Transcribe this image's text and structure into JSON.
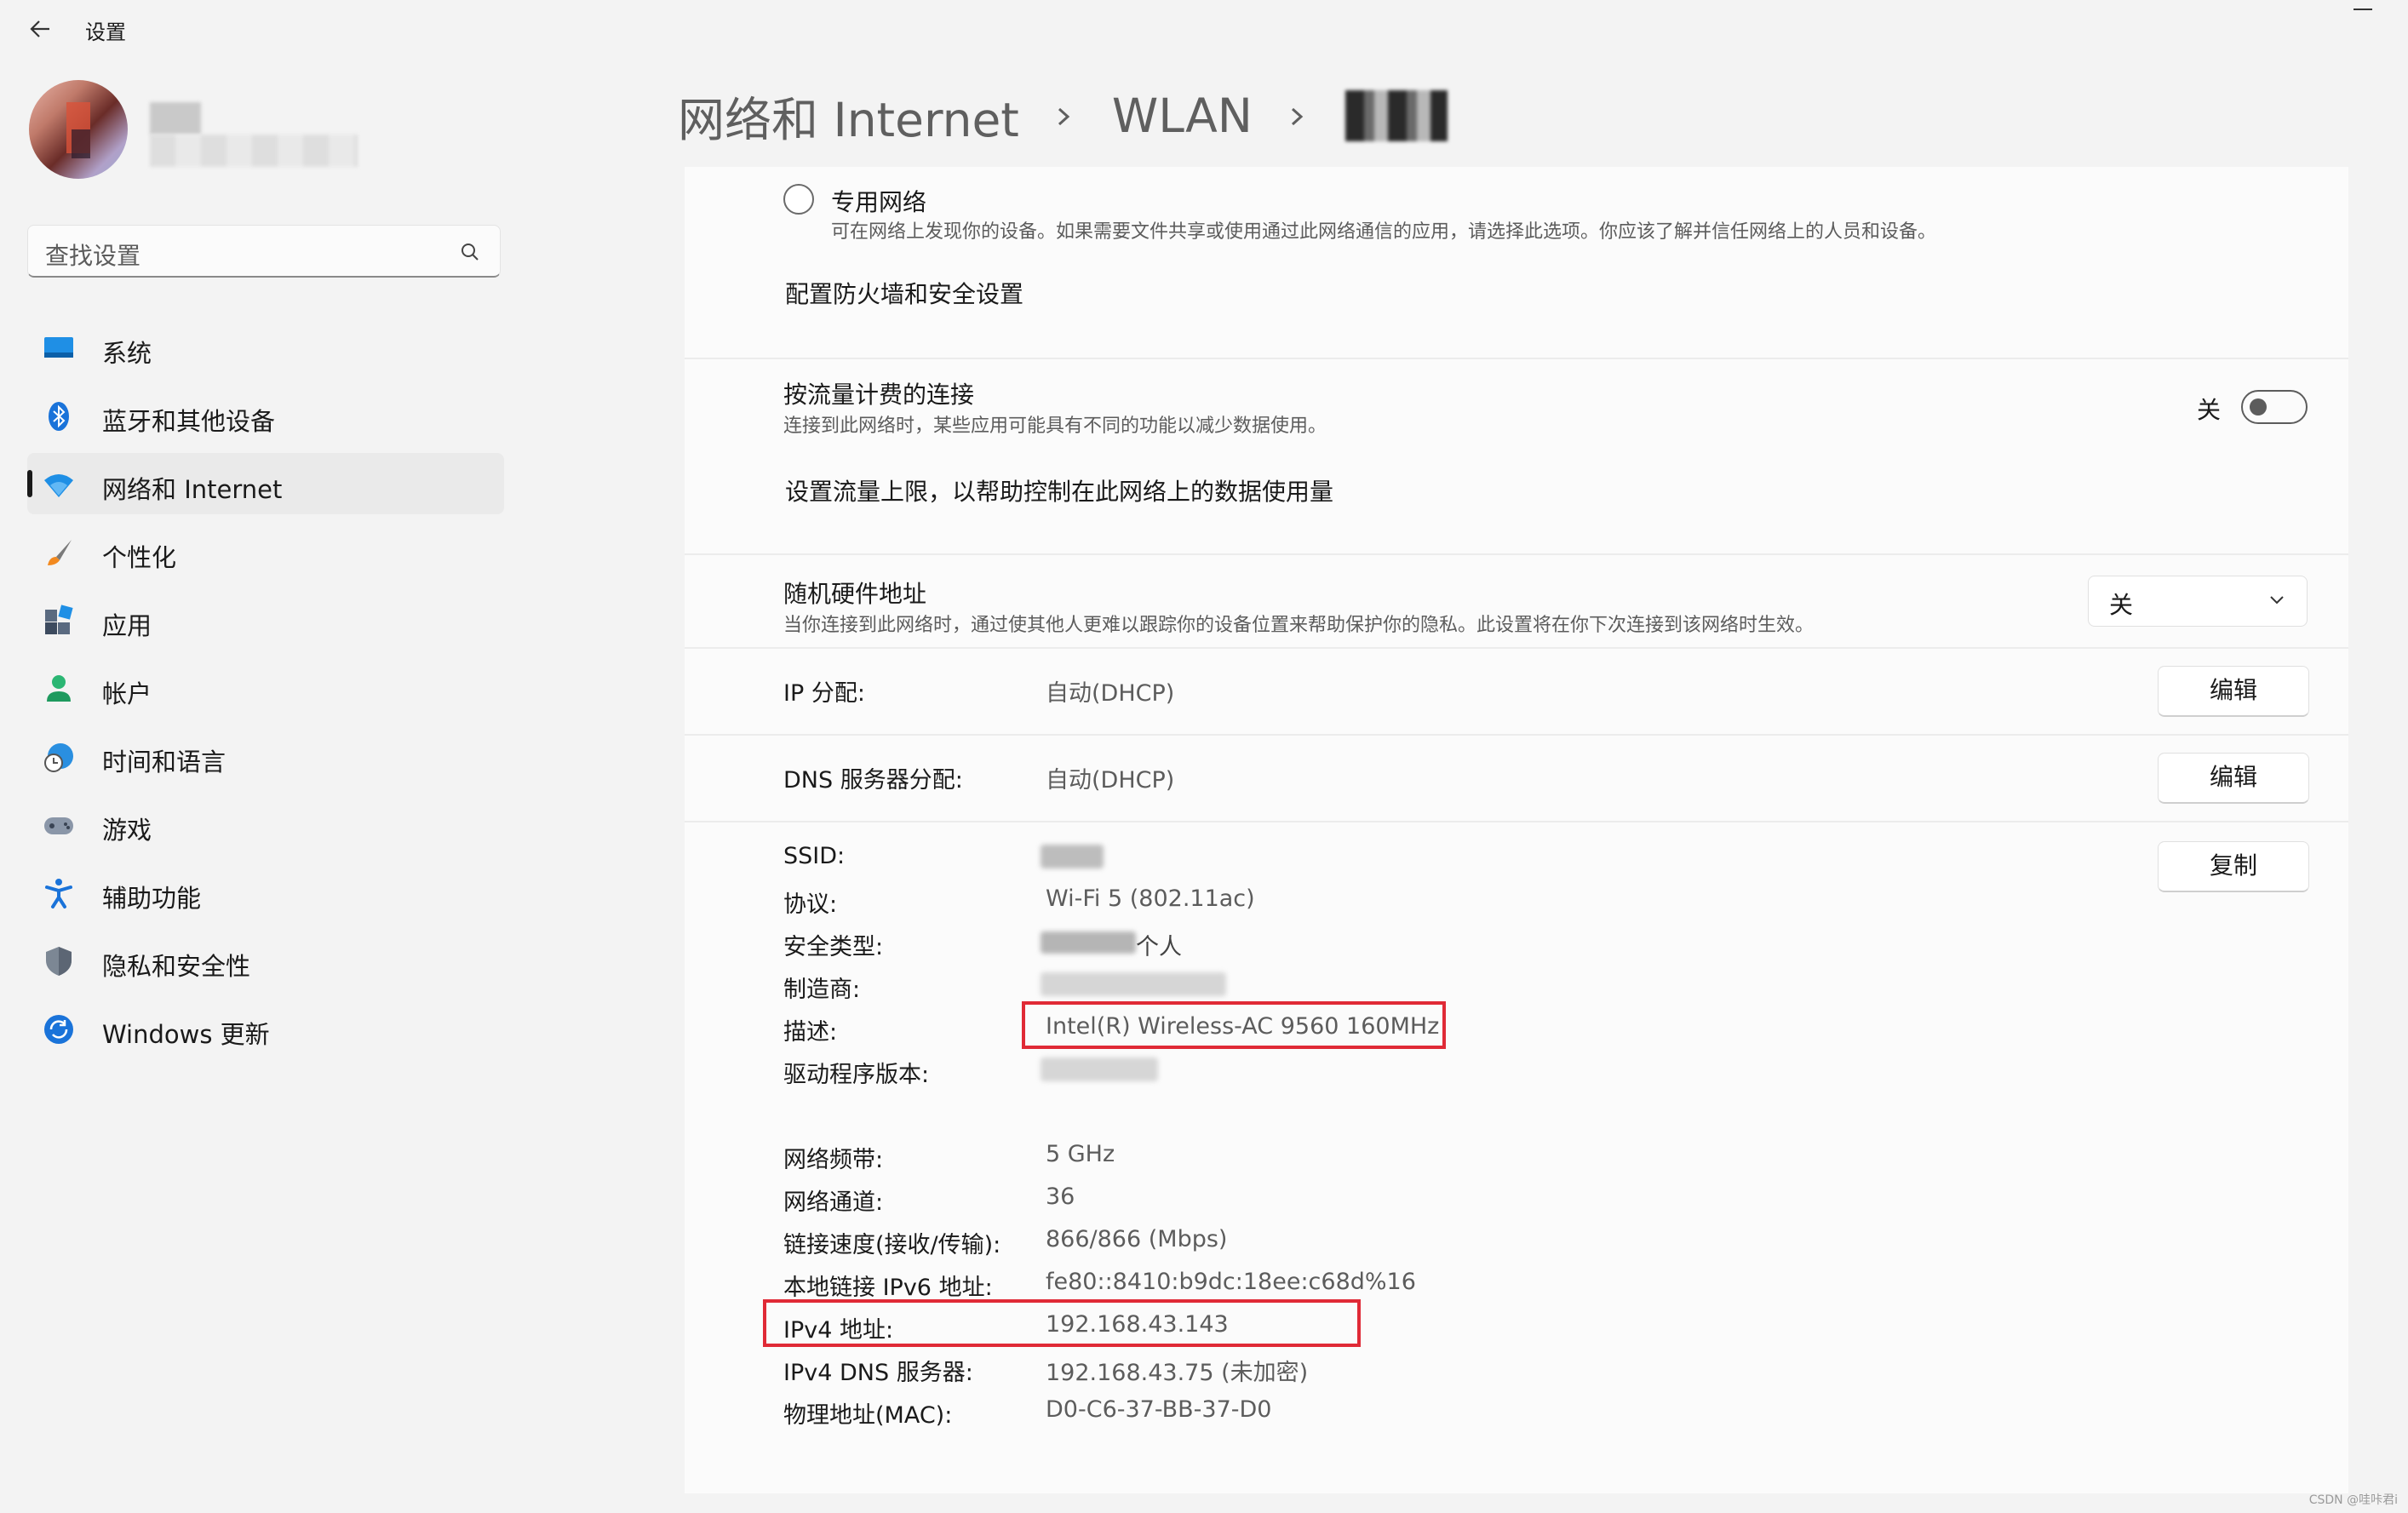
{
  "app": {
    "title": "设置"
  },
  "search": {
    "placeholder": "查找设置"
  },
  "nav": [
    {
      "label": "系统",
      "icon": "system-icon"
    },
    {
      "label": "蓝牙和其他设备",
      "icon": "bluetooth-icon"
    },
    {
      "label": "网络和 Internet",
      "icon": "wifi-icon",
      "active": true
    },
    {
      "label": "个性化",
      "icon": "brush-icon"
    },
    {
      "label": "应用",
      "icon": "apps-icon"
    },
    {
      "label": "帐户",
      "icon": "account-icon"
    },
    {
      "label": "时间和语言",
      "icon": "clock-globe-icon"
    },
    {
      "label": "游戏",
      "icon": "gamepad-icon"
    },
    {
      "label": "辅助功能",
      "icon": "accessibility-icon"
    },
    {
      "label": "隐私和安全性",
      "icon": "shield-icon"
    },
    {
      "label": "Windows 更新",
      "icon": "update-icon"
    }
  ],
  "breadcrumb": {
    "part1": "网络和 Internet",
    "part2": "WLAN"
  },
  "private_network": {
    "title": "专用网络",
    "desc": "可在网络上发现你的设备。如果需要文件共享或使用通过此网络通信的应用，请选择此选项。你应该了解并信任网络上的人员和设备。",
    "link": "配置防火墙和安全设置"
  },
  "metered": {
    "title": "按流量计费的连接",
    "desc": "连接到此网络时，某些应用可能具有不同的功能以减少数据使用。",
    "state": "关",
    "link": "设置流量上限，以帮助控制在此网络上的数据使用量"
  },
  "random_mac": {
    "title": "随机硬件地址",
    "desc": "当你连接到此网络时，通过使其他人更难以跟踪你的设备位置来帮助保护你的隐私。此设置将在你下次连接到该网络时生效。",
    "value": "关"
  },
  "ip": {
    "label": "IP 分配:",
    "value": "自动(DHCP)",
    "button": "编辑"
  },
  "dns": {
    "label": "DNS 服务器分配:",
    "value": "自动(DHCP)",
    "button": "编辑"
  },
  "copy_button": "复制",
  "props": {
    "ssid": "SSID:",
    "protocol": "协议:",
    "protocol_value": "Wi-Fi 5 (802.11ac)",
    "security": "安全类型:",
    "security_value_suffix": "个人",
    "manufacturer": "制造商:",
    "description": "描述:",
    "description_value": "Intel(R) Wireless-AC 9560 160MHz",
    "driver": "驱动程序版本:",
    "band": "网络频带:",
    "band_value": "5 GHz",
    "channel": "网络通道:",
    "channel_value": "36",
    "link_speed": "链接速度(接收/传输):",
    "link_speed_value": "866/866 (Mbps)",
    "ipv6": "本地链接 IPv6 地址:",
    "ipv6_value": "fe80::8410:b9dc:18ee:c68d%16",
    "ipv4": "IPv4 地址:",
    "ipv4_value": "192.168.43.143",
    "ipv4_dns": "IPv4 DNS 服务器:",
    "ipv4_dns_value": "192.168.43.75 (未加密)",
    "mac": "物理地址(MAC):",
    "mac_value": "D0-C6-37-BB-37-D0"
  },
  "watermark": "CSDN @哇咔君i",
  "colors": {
    "highlight": "#e02a36",
    "accent": "#0067c0"
  }
}
